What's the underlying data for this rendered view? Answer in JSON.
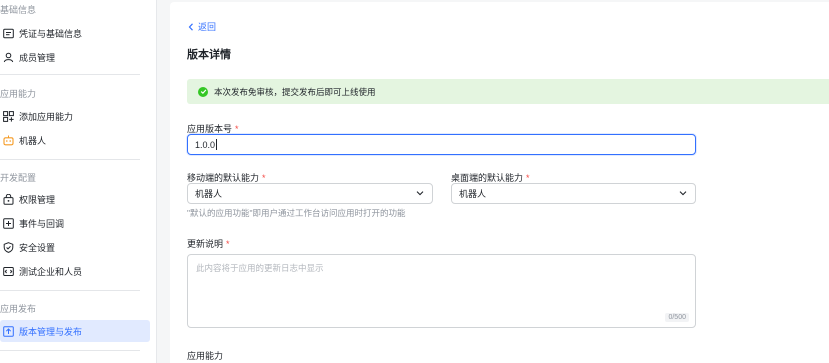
{
  "sidebar": {
    "sections": [
      {
        "title": "基础信息"
      },
      {
        "title": "应用能力"
      },
      {
        "title": "开发配置"
      },
      {
        "title": "应用发布"
      }
    ],
    "items": [
      {
        "label": "凭证与基础信息",
        "icon": "credential-icon"
      },
      {
        "label": "成员管理",
        "icon": "member-icon"
      },
      {
        "label": "添加应用能力",
        "icon": "add-capability-icon"
      },
      {
        "label": "机器人",
        "icon": "robot-icon"
      },
      {
        "label": "权限管理",
        "icon": "permission-icon"
      },
      {
        "label": "事件与回调",
        "icon": "event-icon"
      },
      {
        "label": "安全设置",
        "icon": "shield-icon"
      },
      {
        "label": "测试企业和人员",
        "icon": "test-icon"
      },
      {
        "label": "版本管理与发布",
        "icon": "version-icon",
        "active": true
      }
    ]
  },
  "main": {
    "back_label": "返回",
    "title": "版本详情",
    "notice": "本次发布免审核，提交发布后即可上线使用",
    "version": {
      "label": "应用版本号",
      "value": "1.0.0"
    },
    "mobile_default": {
      "label": "移动端的默认能力",
      "value": "机器人"
    },
    "desktop_default": {
      "label": "桌面端的默认能力",
      "value": "机器人"
    },
    "default_hint": "\"默认的应用功能\"即用户通过工作台访问应用时打开的功能",
    "changelog": {
      "label": "更新说明",
      "placeholder": "此内容将于应用的更新日志中显示",
      "counter": "0/500"
    },
    "capability_label": "应用能力"
  },
  "colors": {
    "accent": "#3370ff",
    "success": "#34c724",
    "required": "#f54a45",
    "notice_bg": "#e4f5e0"
  }
}
